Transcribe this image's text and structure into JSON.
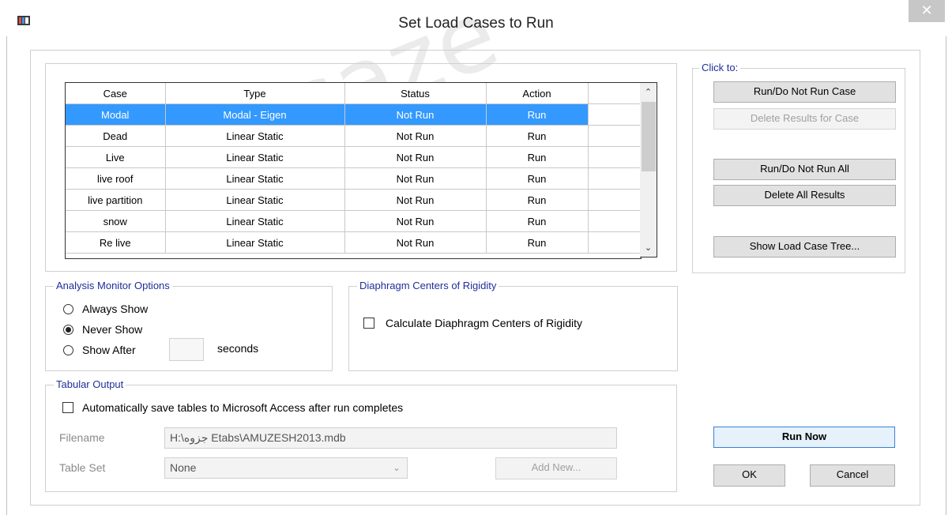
{
  "window": {
    "title": "Set Load Cases to Run",
    "close_glyph": "✕"
  },
  "table": {
    "columns": [
      "Case",
      "Type",
      "Status",
      "Action"
    ],
    "rows": [
      [
        "Modal",
        "Modal - Eigen",
        "Not Run",
        "Run"
      ],
      [
        "Dead",
        "Linear Static",
        "Not Run",
        "Run"
      ],
      [
        "Live",
        "Linear Static",
        "Not Run",
        "Run"
      ],
      [
        "live roof",
        "Linear Static",
        "Not Run",
        "Run"
      ],
      [
        "live partition",
        "Linear Static",
        "Not Run",
        "Run"
      ],
      [
        "snow",
        "Linear Static",
        "Not Run",
        "Run"
      ],
      [
        "Re live",
        "Linear Static",
        "Not Run",
        "Run"
      ]
    ],
    "selected_row": 0
  },
  "click_to": {
    "title": "Click to:",
    "run_do_not_run_case": "Run/Do Not Run Case",
    "delete_results_for_case": "Delete Results for Case",
    "run_do_not_run_all": "Run/Do Not Run All",
    "delete_all_results": "Delete All Results",
    "show_load_case_tree": "Show Load Case Tree..."
  },
  "monitor": {
    "title": "Analysis Monitor Options",
    "always_show": "Always Show",
    "never_show": "Never Show",
    "show_after": "Show After",
    "seconds": "seconds",
    "selected": "Never Show"
  },
  "diaphragm": {
    "title": "Diaphragm Centers of Rigidity",
    "calculate": "Calculate Diaphragm Centers of Rigidity",
    "checked": false
  },
  "tabular": {
    "title": "Tabular Output",
    "auto_save": "Automatically save tables to Microsoft Access after run completes",
    "auto_save_checked": false,
    "filename_label": "Filename",
    "filename_value": "H:\\جزوه Etabs\\AMUZESH2013.mdb",
    "table_set_label": "Table Set",
    "table_set_value": "None",
    "add_new": "Add New..."
  },
  "actions": {
    "run_now": "Run Now",
    "ok": "OK",
    "cancel": "Cancel"
  },
  "watermark": "saze",
  "icons": {
    "app": "app-icon",
    "close": "close-icon",
    "scroll_up": "chevron-up-icon",
    "scroll_down": "chevron-down-icon",
    "dropdown": "chevron-down-icon"
  }
}
